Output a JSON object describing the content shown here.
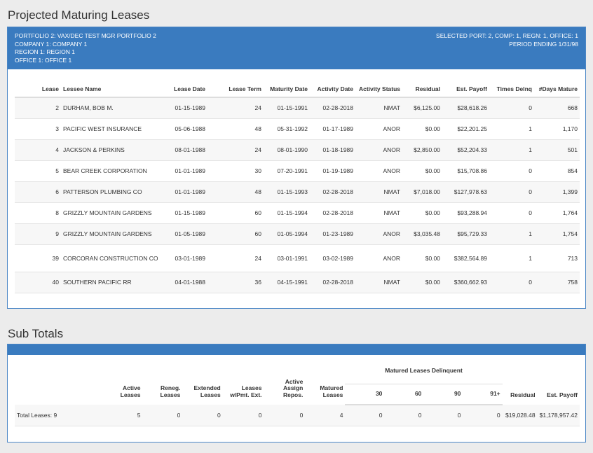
{
  "page": {
    "title": "Projected Maturing Leases",
    "subtotals_title": "Sub Totals"
  },
  "header": {
    "portfolio": "PORTFOLIO  2:  VAX/DEC TEST MGR PORTFOLIO 2",
    "company": "COMPANY  1:  COMPANY 1",
    "region": "REGION  1:  REGION 1",
    "office": "OFFICE  1:  OFFICE 1",
    "selected": "SELECTED PORT: 2, COMP: 1, REGN: 1, OFFICE: 1",
    "period": "PERIOD ENDING 1/31/98"
  },
  "leases": {
    "columns": [
      "Lease",
      "Lessee Name",
      "Lease Date",
      "Lease Term",
      "Maturity Date",
      "Activity Date",
      "Activity Status",
      "Residual",
      "Est. Payoff",
      "Times Delnq",
      "#Days Mature"
    ],
    "rows": [
      [
        "2",
        "DURHAM, BOB M.",
        "01-15-1989",
        "24",
        "01-15-1991",
        "02-28-2018",
        "NMAT",
        "$6,125.00",
        "$28,618.26",
        "0",
        "668"
      ],
      [
        "3",
        "PACIFIC WEST INSURANCE",
        "05-06-1988",
        "48",
        "05-31-1992",
        "01-17-1989",
        "ANOR",
        "$0.00",
        "$22,201.25",
        "1",
        "1,170"
      ],
      [
        "4",
        "JACKSON & PERKINS",
        "08-01-1988",
        "24",
        "08-01-1990",
        "01-18-1989",
        "ANOR",
        "$2,850.00",
        "$52,204.33",
        "1",
        "501"
      ],
      [
        "5",
        "BEAR CREEK CORPORATION",
        "01-01-1989",
        "30",
        "07-20-1991",
        "01-19-1989",
        "ANOR",
        "$0.00",
        "$15,708.86",
        "0",
        "854"
      ],
      [
        "6",
        "PATTERSON PLUMBING CO",
        "01-01-1989",
        "48",
        "01-15-1993",
        "02-28-2018",
        "NMAT",
        "$7,018.00",
        "$127,978.63",
        "0",
        "1,399"
      ],
      [
        "8",
        "GRIZZLY MOUNTAIN GARDENS",
        "01-15-1989",
        "60",
        "01-15-1994",
        "02-28-2018",
        "NMAT",
        "$0.00",
        "$93,288.94",
        "0",
        "1,764"
      ],
      [
        "9",
        "GRIZZLY MOUNTAIN GARDENS",
        "01-05-1989",
        "60",
        "01-05-1994",
        "01-23-1989",
        "ANOR",
        "$3,035.48",
        "$95,729.33",
        "1",
        "1,754"
      ],
      [
        "39",
        "CORCORAN CONSTRUCTION CO",
        "03-01-1989",
        "24",
        "03-01-1991",
        "03-02-1989",
        "ANOR",
        "$0.00",
        "$382,564.89",
        "1",
        "713"
      ],
      [
        "40",
        "SOUTHERN PACIFIC RR",
        "04-01-1988",
        "36",
        "04-15-1991",
        "02-28-2018",
        "NMAT",
        "$0.00",
        "$360,662.93",
        "0",
        "758"
      ]
    ]
  },
  "subtotals": {
    "headers": {
      "active": "Active Leases",
      "reneg": "Reneg. Leases",
      "extended": "Extended Leases",
      "leases_pmt": "Leases w/Pmt. Ext.",
      "active_assign": "Active Assign Repos.",
      "matured": "Matured Leases",
      "delinquent_group": "Matured Leases Delinquent",
      "d30": "30",
      "d60": "60",
      "d90": "90",
      "d91": "91+",
      "residual": "Residual",
      "payoff": "Est. Payoff"
    },
    "row": {
      "label": "Total Leases: 9",
      "active": "5",
      "reneg": "0",
      "extended": "0",
      "leases_pmt": "0",
      "active_assign": "0",
      "matured": "4",
      "d30": "0",
      "d60": "0",
      "d90": "0",
      "d91": "0",
      "residual": "$19,028.48",
      "payoff": "$1,178,957.42"
    }
  },
  "colors": {
    "header_blue": "#3a7bbf",
    "panel_border": "#4a86c5",
    "background": "#ececec"
  }
}
